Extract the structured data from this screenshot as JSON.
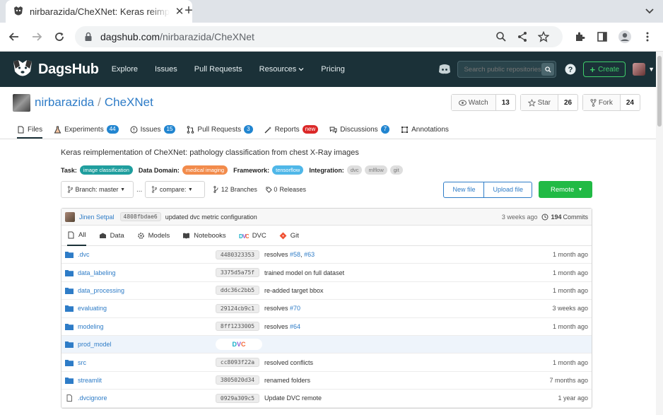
{
  "browser": {
    "tab_title": "nirbarazida/CheXNet: Keras reimplementation of CheXNet",
    "url_host": "dagshub.com",
    "url_path": "/nirbarazida/CheXNet"
  },
  "header": {
    "brand": "DagsHub",
    "nav": [
      "Explore",
      "Issues",
      "Pull Requests",
      "Resources",
      "Pricing"
    ],
    "search_placeholder": "Search public repositories...",
    "create_label": "Create"
  },
  "repo": {
    "owner": "nirbarazida",
    "name": "CheXNet",
    "watch_label": "Watch",
    "watch_count": "13",
    "star_label": "Star",
    "star_count": "26",
    "fork_label": "Fork",
    "fork_count": "24"
  },
  "repo_tabs": [
    {
      "label": "Files"
    },
    {
      "label": "Experiments",
      "badge": "44"
    },
    {
      "label": "Issues",
      "badge": "15"
    },
    {
      "label": "Pull Requests",
      "badge": "3"
    },
    {
      "label": "Reports",
      "badge": "new"
    },
    {
      "label": "Discussions",
      "badge": "7"
    },
    {
      "label": "Annotations"
    }
  ],
  "description": "Keras reimplementation of CheXNet: pathology classification from chest X-Ray images",
  "meta": {
    "task_label": "Task:",
    "task": "image classification",
    "domain_label": "Data Domain:",
    "domain": "medical imaging",
    "framework_label": "Framework:",
    "framework": "tensorflow",
    "integration_label": "Integration:",
    "integrations": [
      "dvc",
      "mlflow",
      "git"
    ]
  },
  "branchbar": {
    "branch": "Branch: master",
    "dots": "...",
    "compare": "compare:",
    "branches_count": "12",
    "branches_label": "Branches",
    "releases_count": "0",
    "releases_label": "Releases",
    "new_file": "New file",
    "upload_file": "Upload file",
    "remote": "Remote"
  },
  "last_commit": {
    "author": "Jinen Setpal",
    "sha": "4808fbdae6",
    "message": "updated dvc metric configuration",
    "time": "3 weeks ago",
    "commits_count": "194",
    "commits_label": "Commits"
  },
  "file_tabs": [
    "All",
    "Data",
    "Models",
    "Notebooks",
    "DVC",
    "Git"
  ],
  "files": [
    {
      "name": ".dvc",
      "type": "folder",
      "sha": "4480323353",
      "msg": "resolves ",
      "links": [
        "#58",
        "#63"
      ],
      "time": "1 month ago"
    },
    {
      "name": "data_labeling",
      "type": "folder",
      "sha": "3375d5a75f",
      "msg": "trained model on full dataset",
      "links": [],
      "time": "1 month ago"
    },
    {
      "name": "data_processing",
      "type": "folder",
      "sha": "ddc36c2bb5",
      "msg": "re-added target bbox",
      "links": [],
      "time": "1 month ago"
    },
    {
      "name": "evaluating",
      "type": "folder",
      "sha": "29124cb9c1",
      "msg": "resolves ",
      "links": [
        "#70"
      ],
      "time": "3 weeks ago"
    },
    {
      "name": "modeling",
      "type": "folder",
      "sha": "8ff1233005",
      "msg": "resolves ",
      "links": [
        "#64"
      ],
      "time": "1 month ago"
    },
    {
      "name": "prod_model",
      "type": "dvc-folder",
      "sha": "",
      "msg": "",
      "links": [],
      "time": ""
    },
    {
      "name": "src",
      "type": "folder",
      "sha": "cc8093f22a",
      "msg": "resolved conflicts",
      "links": [],
      "time": "1 month ago"
    },
    {
      "name": "streamlit",
      "type": "folder",
      "sha": "3805020d34",
      "msg": "renamed folders",
      "links": [],
      "time": "7 months ago"
    },
    {
      "name": ".dvcignore",
      "type": "file",
      "sha": "0929a309c5",
      "msg": "Update DVC remote",
      "links": [],
      "time": "1 year ago"
    }
  ],
  "colors": {
    "header_bg": "#1b3138",
    "link": "#2e7cc7",
    "green": "#21ba45"
  }
}
